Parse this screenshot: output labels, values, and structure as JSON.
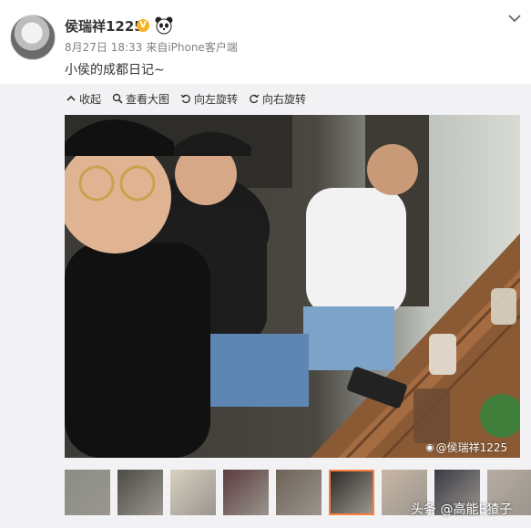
{
  "post": {
    "username": "侯瑞祥1225",
    "verified_badge": "V",
    "date": "8月27日 18:33",
    "source": "来自iPhone客户端",
    "text": "小侯的成都日记~"
  },
  "toolbar": {
    "collapse": "收起",
    "view_large": "查看大图",
    "rotate_left": "向左旋转",
    "rotate_right": "向右旋转"
  },
  "photo": {
    "watermark": "@侯瑞祥1225"
  },
  "thumbnails": [
    {
      "active": false,
      "color": "#8a8f86"
    },
    {
      "active": false,
      "color": "#4d4b47"
    },
    {
      "active": false,
      "color": "#d8d1c2"
    },
    {
      "active": false,
      "color": "#5a3b3e"
    },
    {
      "active": false,
      "color": "#6d6256"
    },
    {
      "active": true,
      "color": "#2f2b28"
    },
    {
      "active": false,
      "color": "#c9b7a6"
    },
    {
      "active": false,
      "color": "#3a3a44"
    },
    {
      "active": false,
      "color": "#b7aca2"
    }
  ],
  "footer_brand": "头条 @高能E猹子",
  "colors": {
    "accent": "#fa7d3c",
    "badge": "#f6b426"
  }
}
